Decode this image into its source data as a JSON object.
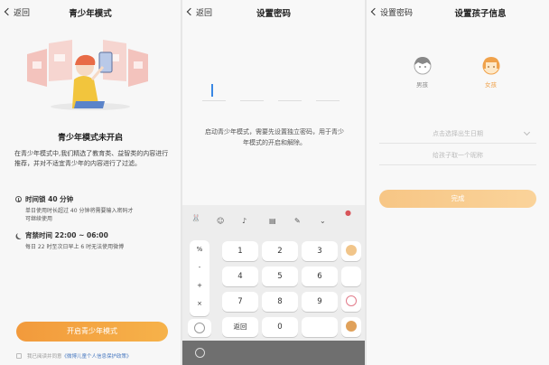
{
  "panel1": {
    "back_label": "返回",
    "title": "青少年模式",
    "heading": "青少年模式未开启",
    "description": "在青少年模式中,我们精选了教育类、益智类的内容进行推荐，并对不适宜青少年的内容进行了过滤。",
    "rules": [
      {
        "icon": "clock-icon",
        "title": "时间锁 40 分钟",
        "desc_line1": "单日使用时长超过 40 分钟将需要输入密码才",
        "desc_line2": "可继续使用"
      },
      {
        "icon": "moon-icon",
        "title": "宵禁时间 22:00 ~ 06:00",
        "desc_line1": "每日 22 时至次日早上 6 时无法使用微博"
      }
    ],
    "primary_button": "开启青少年模式",
    "agreement_prefix": "我已阅读并同意",
    "agreement_link": "《微博儿童个人信息保护政策》"
  },
  "panel2": {
    "back_label": "返回",
    "title": "设置密码",
    "hint_line1": "启动青少年模式，需要先设置独立密码，用于青少",
    "hint_line2": "年模式的开启和解除。",
    "symbols": [
      "%",
      "-",
      "+",
      "×"
    ],
    "keys": [
      {
        "label": "1",
        "name": "key-1"
      },
      {
        "label": "2",
        "name": "key-2"
      },
      {
        "label": "3",
        "name": "key-3"
      },
      {
        "label": "4",
        "name": "key-4"
      },
      {
        "label": "5",
        "name": "key-5"
      },
      {
        "label": "6",
        "name": "key-6"
      },
      {
        "label": "7",
        "name": "key-7"
      },
      {
        "label": "8",
        "name": "key-8"
      },
      {
        "label": "9",
        "name": "key-9"
      },
      {
        "label": "返回",
        "name": "key-return"
      },
      {
        "label": "0",
        "name": "key-0"
      },
      {
        "label": "",
        "name": "key-space"
      }
    ]
  },
  "panel3": {
    "back_label": "设置密码",
    "title": "设置孩子信息",
    "boy_label": "男孩",
    "girl_label": "女孩",
    "birthday_placeholder": "点击选择出生日期",
    "nickname_placeholder": "给孩子取一个昵称",
    "done_button": "完成"
  },
  "colors": {
    "accent": "#f29a3c",
    "accent_light": "#f8cd92",
    "link": "#4a7ac0"
  }
}
